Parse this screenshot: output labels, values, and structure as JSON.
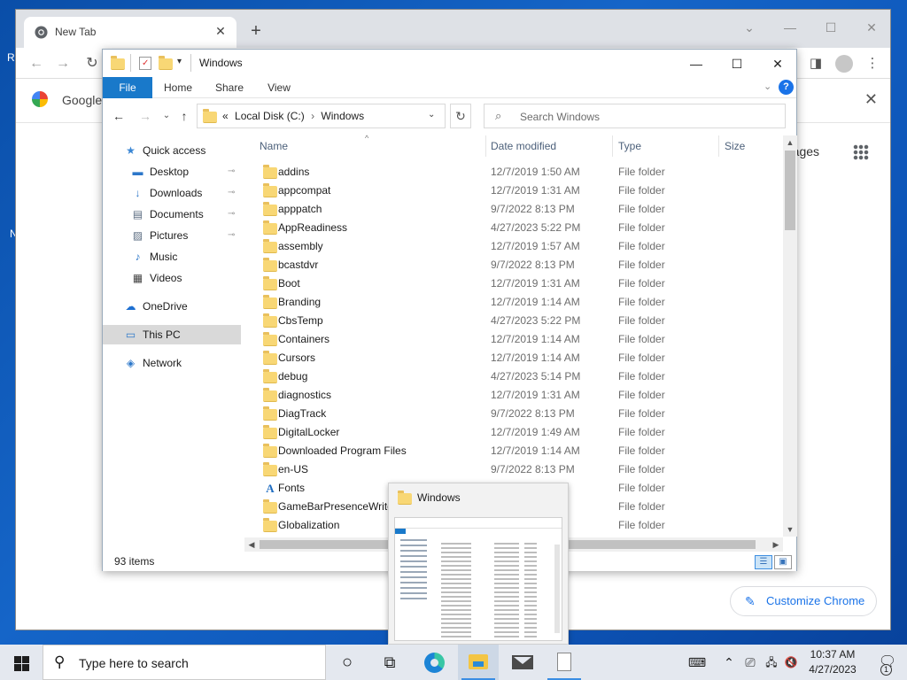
{
  "desktop": {
    "letters": [
      "R",
      "N"
    ]
  },
  "chrome": {
    "tab_title": "New Tab",
    "tab_close": "✕",
    "new_tab": "+",
    "window_controls": {
      "chevron": "⌄",
      "minimize": "—",
      "maximize": "☐",
      "close": "✕"
    },
    "toolbar": {
      "back": "←",
      "forward": "→",
      "reload": "↻",
      "sidepanel": "◨",
      "menu": "⋮"
    },
    "bookmark": {
      "label": "Google",
      "close": "✕"
    },
    "images_link": "mages",
    "customize_label": "Customize Chrome",
    "customize_icon": "✎"
  },
  "explorer": {
    "title": "Windows",
    "qat_arrow": "▾",
    "window_controls": {
      "minimize": "—",
      "maximize": "☐",
      "close": "✕"
    },
    "ribbon": {
      "tabs": [
        "File",
        "Home",
        "Share",
        "View"
      ],
      "expand": "⌄",
      "help": "?"
    },
    "nav": {
      "back": "←",
      "forward": "→",
      "recent": "⌄",
      "up": "↑"
    },
    "address": {
      "prefix": "«",
      "crumbs": [
        "Local Disk (C:)",
        "Windows"
      ],
      "sep": "›",
      "dropdown": "⌄",
      "refresh": "↻"
    },
    "search": {
      "placeholder": "Search Windows",
      "icon": "⌕"
    },
    "navpane": [
      {
        "label": "Quick access",
        "icon": "★",
        "color": "#3a86d4",
        "pinned": false,
        "level": 0
      },
      {
        "label": "Desktop",
        "icon": "▬",
        "color": "#2c77c9",
        "pinned": true,
        "level": 1
      },
      {
        "label": "Downloads",
        "icon": "↓",
        "color": "#2c77c9",
        "pinned": true,
        "level": 1
      },
      {
        "label": "Documents",
        "icon": "▤",
        "color": "#5a6b80",
        "pinned": true,
        "level": 1
      },
      {
        "label": "Pictures",
        "icon": "▨",
        "color": "#5a6b80",
        "pinned": true,
        "level": 1
      },
      {
        "label": "Music",
        "icon": "♪",
        "color": "#2c77c9",
        "pinned": false,
        "level": 1
      },
      {
        "label": "Videos",
        "icon": "▦",
        "color": "#444",
        "pinned": false,
        "level": 1
      },
      {
        "label": "OneDrive",
        "icon": "☁",
        "color": "#1d6fd1",
        "pinned": false,
        "level": 0
      },
      {
        "label": "This PC",
        "icon": "▭",
        "color": "#2c77c9",
        "pinned": false,
        "level": 0,
        "selected": true
      },
      {
        "label": "Network",
        "icon": "◈",
        "color": "#2c77c9",
        "pinned": false,
        "level": 0
      }
    ],
    "pin_glyph": "📌",
    "columns": {
      "name": "Name",
      "date": "Date modified",
      "type": "Type",
      "size": "Size",
      "sort_arrow": "^"
    },
    "files": [
      {
        "name": "addins",
        "date": "12/7/2019 1:50 AM",
        "type": "File folder"
      },
      {
        "name": "appcompat",
        "date": "12/7/2019 1:31 AM",
        "type": "File folder"
      },
      {
        "name": "apppatch",
        "date": "9/7/2022 8:13 PM",
        "type": "File folder"
      },
      {
        "name": "AppReadiness",
        "date": "4/27/2023 5:22 PM",
        "type": "File folder"
      },
      {
        "name": "assembly",
        "date": "12/7/2019 1:57 AM",
        "type": "File folder"
      },
      {
        "name": "bcastdvr",
        "date": "9/7/2022 8:13 PM",
        "type": "File folder"
      },
      {
        "name": "Boot",
        "date": "12/7/2019 1:31 AM",
        "type": "File folder"
      },
      {
        "name": "Branding",
        "date": "12/7/2019 1:14 AM",
        "type": "File folder"
      },
      {
        "name": "CbsTemp",
        "date": "4/27/2023 5:22 PM",
        "type": "File folder"
      },
      {
        "name": "Containers",
        "date": "12/7/2019 1:14 AM",
        "type": "File folder"
      },
      {
        "name": "Cursors",
        "date": "12/7/2019 1:14 AM",
        "type": "File folder"
      },
      {
        "name": "debug",
        "date": "4/27/2023 5:14 PM",
        "type": "File folder"
      },
      {
        "name": "diagnostics",
        "date": "12/7/2019 1:31 AM",
        "type": "File folder"
      },
      {
        "name": "DiagTrack",
        "date": "9/7/2022 8:13 PM",
        "type": "File folder"
      },
      {
        "name": "DigitalLocker",
        "date": "12/7/2019 1:49 AM",
        "type": "File folder"
      },
      {
        "name": "Downloaded Program Files",
        "date": "12/7/2019 1:14 AM",
        "type": "File folder"
      },
      {
        "name": "en-US",
        "date": "9/7/2022 8:13 PM",
        "type": "File folder"
      },
      {
        "name": "Fonts",
        "date": "",
        "type": "File folder",
        "icon": "A"
      },
      {
        "name": "GameBarPresenceWriter",
        "date": "",
        "type": "File folder"
      },
      {
        "name": "Globalization",
        "date": "",
        "type": "File folder"
      }
    ],
    "scroll": {
      "up": "▲",
      "down": "▼",
      "left": "◀",
      "right": "▶"
    },
    "status": {
      "count": "93 items",
      "details_view": "☰",
      "tiles_view": "▣"
    }
  },
  "thumbnail": {
    "title": "Windows",
    "close": "✕"
  },
  "taskbar": {
    "search_placeholder": "Type here to search",
    "search_icon": "⚲",
    "cortana": "○",
    "taskview": "⧉",
    "tray": {
      "keyboard": "⌨",
      "chevron": "⌃",
      "meet": "⎚",
      "network": "🖧",
      "volume": "🔇"
    },
    "time": "10:37 AM",
    "date": "4/27/2023",
    "notifications": "🗨",
    "notif_count": "1"
  },
  "colors": {
    "accent": "#1979ca",
    "selected_nav": "#d9d9d9",
    "link": "#1a73e8"
  }
}
